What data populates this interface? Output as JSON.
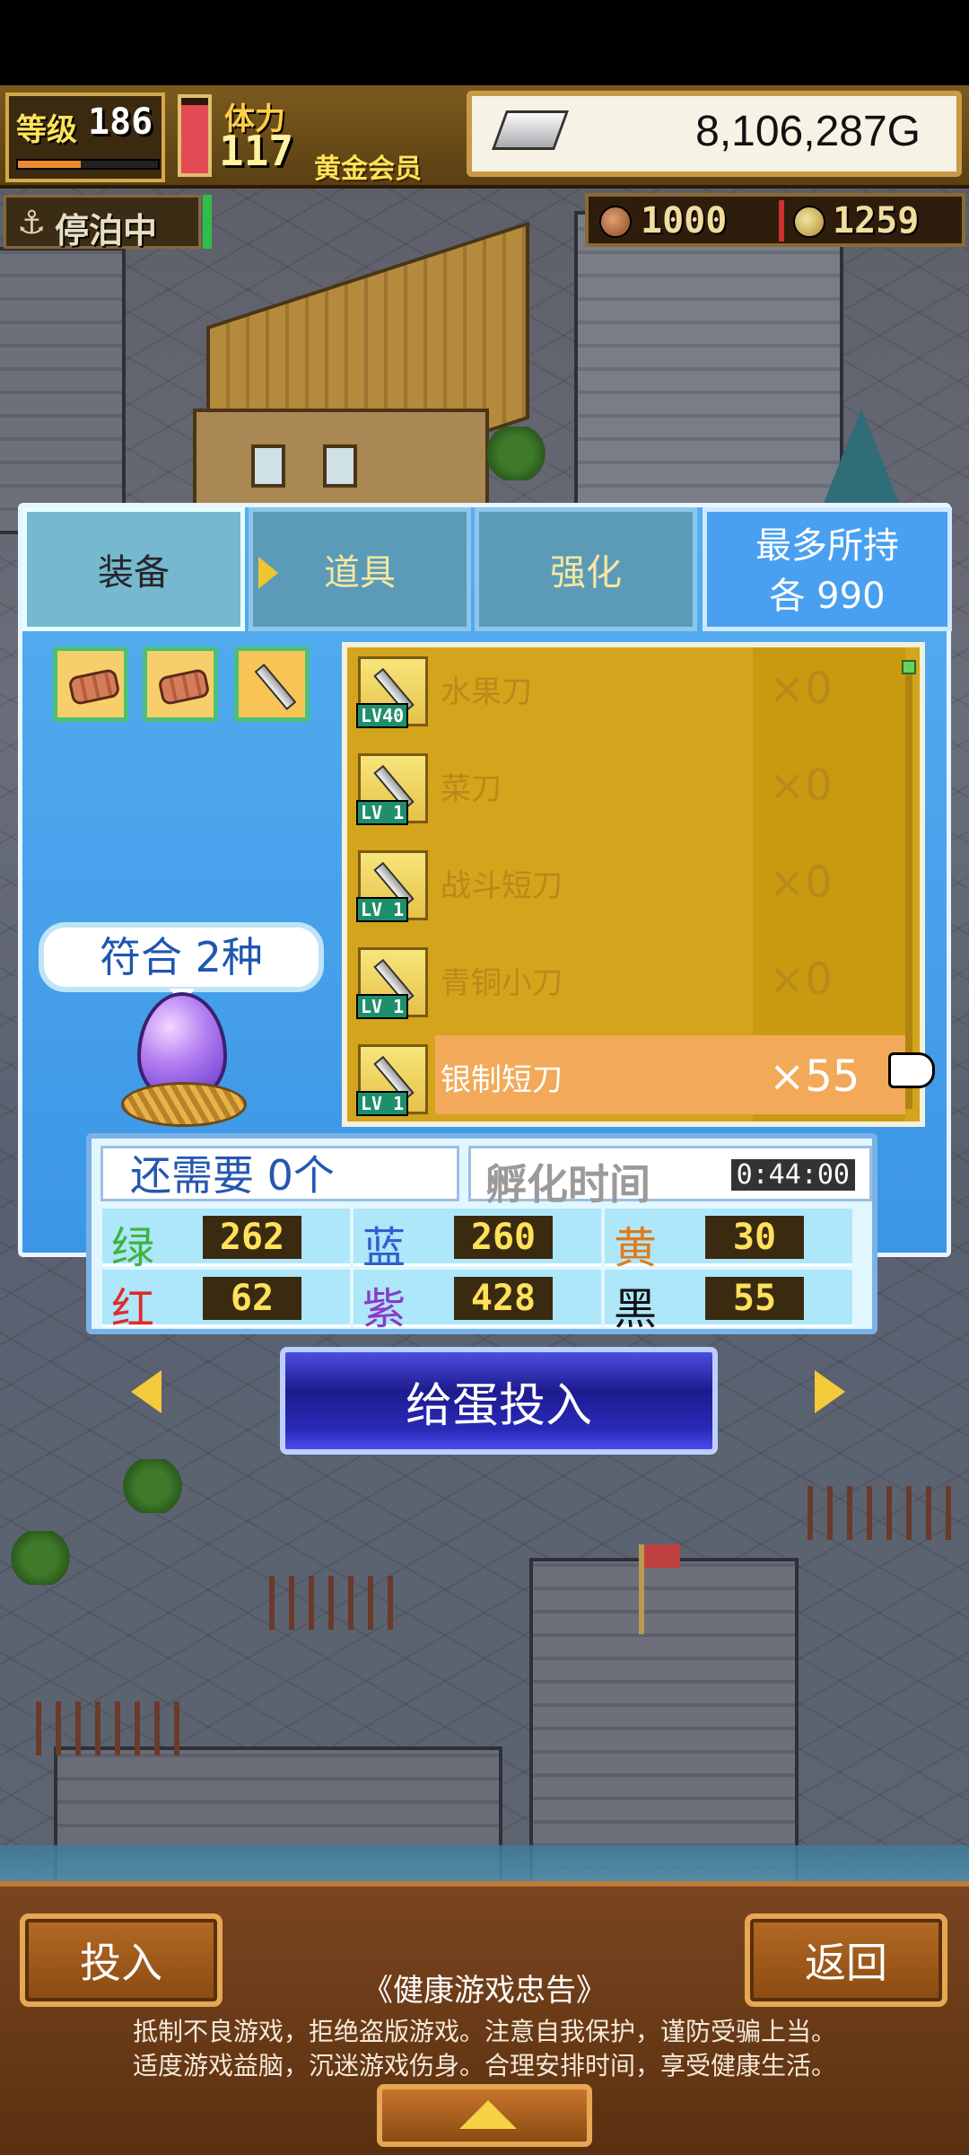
{
  "hud": {
    "level_label": "等级",
    "level_value": "186",
    "level_progress": 0.45,
    "stamina_label": "体力",
    "stamina_value": "117",
    "stamina_fill": 0.9,
    "member_label": "黄金会员",
    "gold_value": "8,106,287G",
    "gold_icon": "silver-ingot-icon",
    "docked_label": "停泊中",
    "docked_icon": "anchor-icon",
    "resource_1": "1000",
    "resource_1_icon": "meat-icon",
    "resource_2": "1259",
    "resource_2_icon": "medal-icon"
  },
  "tabs": [
    {
      "label": "装备",
      "active": true
    },
    {
      "label": "道具",
      "active": false
    },
    {
      "label": "强化",
      "active": false
    }
  ],
  "max_hold": {
    "line1": "最多所持",
    "line2": "各 990"
  },
  "category_icons": [
    "meat-icon",
    "meat-icon",
    "knife-icon"
  ],
  "egg": {
    "match_label": "符合 2种"
  },
  "items": [
    {
      "level": "LV40",
      "name": "水果刀",
      "qty": "×0",
      "selected": false
    },
    {
      "level": "LV 1",
      "name": "菜刀",
      "qty": "×0",
      "selected": false
    },
    {
      "level": "LV 1",
      "name": "战斗短刀",
      "qty": "×0",
      "selected": false
    },
    {
      "level": "LV 1",
      "name": "青铜小刀",
      "qty": "×0",
      "selected": false
    },
    {
      "level": "LV 1",
      "name": "银制短刀",
      "qty": "×55",
      "selected": true
    }
  ],
  "stats": {
    "need_label": "还需要 0个",
    "hatch_label": "孵化时间",
    "hatch_time": "0:44:00",
    "values": [
      {
        "key": "绿",
        "value": "262",
        "color": "#3cb43c"
      },
      {
        "key": "蓝",
        "value": "260",
        "color": "#2f5fd0"
      },
      {
        "key": "黄",
        "value": "30",
        "color": "#e07a1c"
      },
      {
        "key": "红",
        "value": "62",
        "color": "#e02a2a"
      },
      {
        "key": "紫",
        "value": "428",
        "color": "#8a3ac8"
      },
      {
        "key": "黑",
        "value": "55",
        "color": "#111111"
      }
    ]
  },
  "feed_button": "给蛋投入",
  "bottom": {
    "left_button": "投入",
    "right_button": "返回",
    "notice_title": "《健康游戏忠告》",
    "notice_line1": "抵制不良游戏，拒绝盗版游戏。注意自我保护，谨防受骗上当。",
    "notice_line2": "适度游戏益脑，沉迷游戏伤身。合理安排时间，享受健康生活。"
  }
}
